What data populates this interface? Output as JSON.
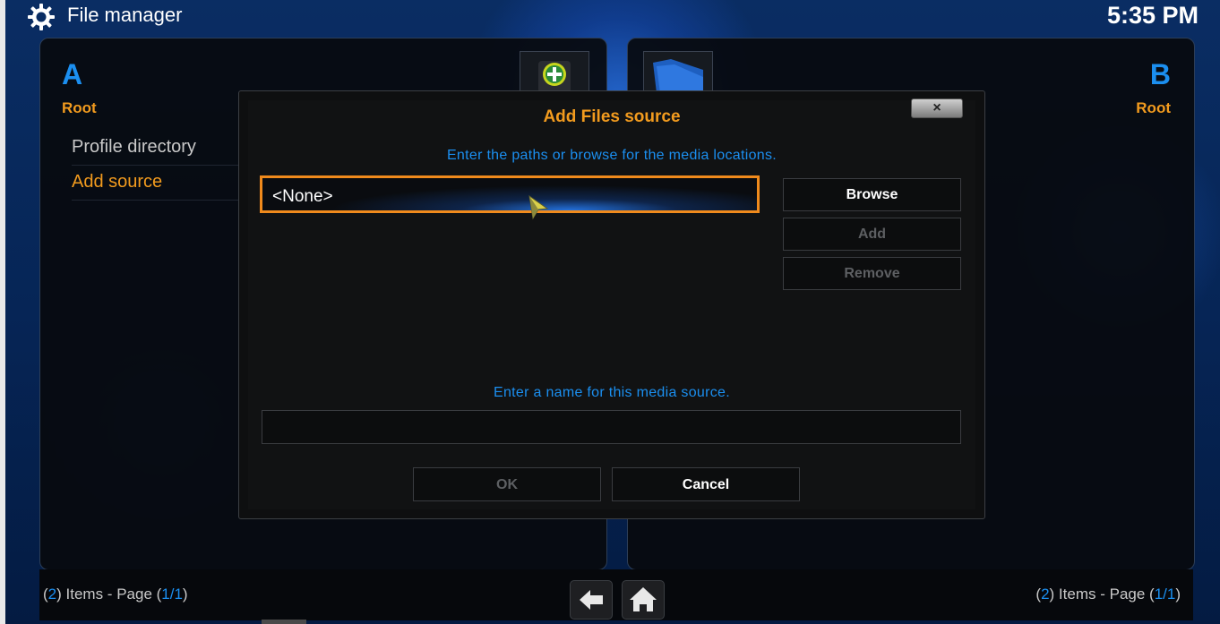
{
  "header": {
    "title": "File manager",
    "clock": "5:35 PM",
    "icon": "gear-icon"
  },
  "pane_a": {
    "letter": "A",
    "root_label": "Root",
    "items": [
      {
        "label": "Profile directory"
      },
      {
        "label": "Add source"
      }
    ]
  },
  "pane_b": {
    "letter": "B",
    "root_label": "Root"
  },
  "footer": {
    "left": {
      "open": "(",
      "count": "2",
      "mid": ") Items - Page (",
      "page": "1/1",
      "close": ")"
    },
    "right": {
      "open": "(",
      "count": "2",
      "mid": ") Items - Page (",
      "page": "1/1",
      "close": ")"
    },
    "back_icon": "back-arrow-icon",
    "home_icon": "home-icon"
  },
  "dialog": {
    "title": "Add Files source",
    "close_label": "×",
    "paths_hint": "Enter the paths or browse for the media locations.",
    "path_entry": "<None>",
    "browse_label": "Browse",
    "add_label": "Add",
    "remove_label": "Remove",
    "name_hint": "Enter a name for this media source.",
    "name_value": "",
    "ok_label": "OK",
    "cancel_label": "Cancel"
  },
  "colors": {
    "accent_blue": "#1b8ff0",
    "accent_orange": "#f29b1e",
    "focus_border": "#f08a1c"
  }
}
